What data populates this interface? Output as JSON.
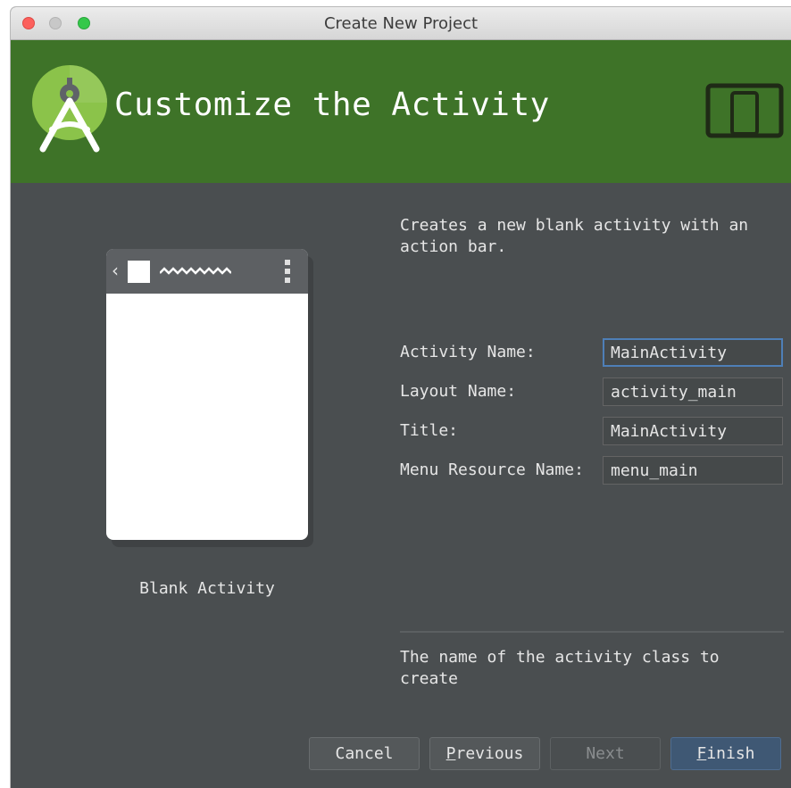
{
  "window": {
    "title": "Create New Project"
  },
  "header": {
    "title": "Customize the Activity",
    "logo_icon": "android-studio-logo-icon",
    "device_icon": "phone-tablet-icon",
    "background_color": "#3e7328"
  },
  "template": {
    "name": "Blank Activity",
    "description": "Creates a new blank activity with an\naction bar."
  },
  "form": {
    "fields": [
      {
        "label": "Activity Name:",
        "value": "MainActivity",
        "focused": true
      },
      {
        "label": "Layout Name:",
        "value": "activity_main"
      },
      {
        "label": "Title:",
        "value": "MainActivity"
      },
      {
        "label": "Menu Resource Name:",
        "value": "menu_main"
      }
    ]
  },
  "help_text": "The name of the activity class to\ncreate",
  "buttons": {
    "cancel": {
      "label": "Cancel"
    },
    "previous": {
      "mnemonic": "P",
      "rest": "revious"
    },
    "next": {
      "label": "Next",
      "enabled": false
    },
    "finish": {
      "mnemonic": "F",
      "rest": "inish",
      "default": true
    }
  }
}
